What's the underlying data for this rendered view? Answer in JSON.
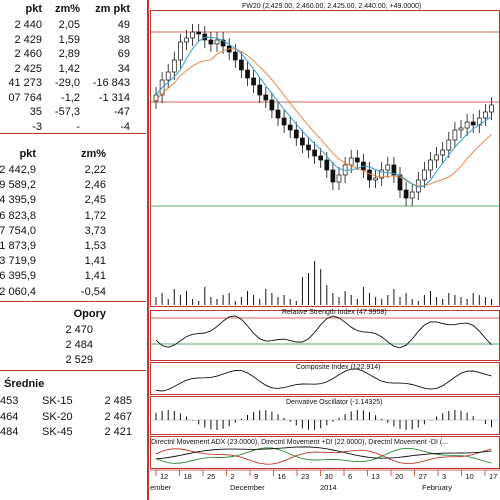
{
  "quotes_table": {
    "headers": [
      "pkt",
      "zm%",
      "zm pkt"
    ],
    "rows": [
      [
        "2 440",
        "2,05",
        "49"
      ],
      [
        "2 429",
        "1,59",
        "38"
      ],
      [
        "2 460",
        "2,89",
        "69"
      ],
      [
        "2 425",
        "1,42",
        "34"
      ],
      [
        "41 273",
        "-29,0",
        "-16 843"
      ],
      [
        "07 764",
        "-1,2",
        "-1 314"
      ],
      [
        "35",
        "-57,3",
        "-47"
      ],
      [
        "-3",
        "-",
        "-4"
      ]
    ]
  },
  "index_table": {
    "headers": [
      "pkt",
      "zm%"
    ],
    "rows": [
      [
        "2 442,9",
        "2,22"
      ],
      [
        "9 589,2",
        "2,46"
      ],
      [
        "4 395,9",
        "2,45"
      ],
      [
        "6 823,8",
        "1,72"
      ],
      [
        "17 754,0",
        "3,73"
      ],
      [
        "1 873,9",
        "1,53"
      ],
      [
        "3 719,9",
        "1,41"
      ],
      [
        "16 395,9",
        "1,41"
      ],
      [
        "2 060,4",
        "-0,54"
      ]
    ]
  },
  "resistance": {
    "title": "Opory",
    "values": [
      "2 470",
      "2 484",
      "2 529"
    ]
  },
  "averages": {
    "title": "Średnie",
    "rows": [
      [
        "453",
        "SK-15",
        "2 485"
      ],
      [
        "464",
        "SK-20",
        "2 467"
      ],
      [
        "484",
        "SK-45",
        "2 421"
      ]
    ]
  },
  "chart": {
    "main_title": "FW20 (2,429.00, 2,460.00, 2,425.00, 2,440.00, +49.0000)",
    "rsi_title": "Relative Strength Index (47.9958)",
    "composite_title": "Composite Index (122.914)",
    "derivative_title": "Derivative Oscillator (-1.14325)",
    "adx_title": "Directnl Movement ADX (23.0000), Directnl Movement +DI (22.0000), Directnl Movement -DI (...",
    "date_ticks": [
      "12",
      "18",
      "25",
      "2",
      "9",
      "16",
      "23",
      "30",
      "6",
      "13",
      "20",
      "27",
      "3",
      "10",
      "17"
    ],
    "month_labels": [
      "ember",
      "December",
      "2014",
      "February"
    ],
    "colors": {
      "panel_border": "#c0392b",
      "candle": "#111111",
      "ma_short": "#3a9ec8",
      "ma_long": "#e8894a",
      "level_red": "#c0392b",
      "level_green": "#2e8b3a",
      "plus_di": "#2e8b3a",
      "minus_di": "#c0392b"
    }
  }
}
